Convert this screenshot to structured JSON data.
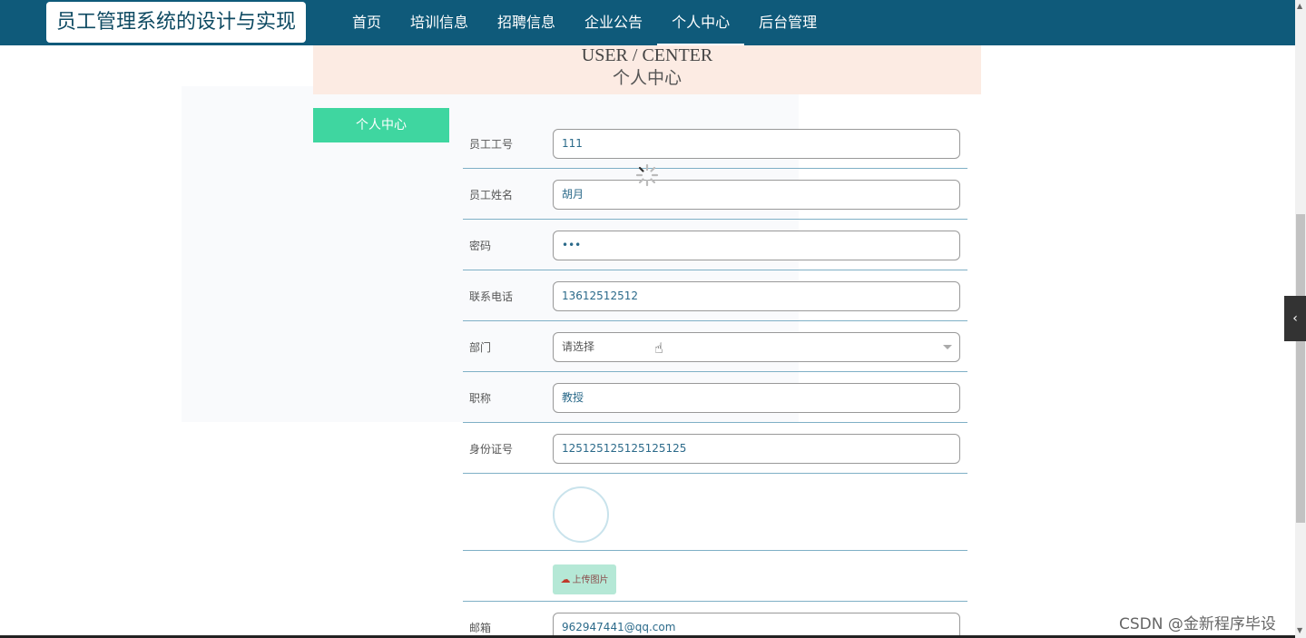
{
  "site": {
    "title": "员工管理系统的设计与实现"
  },
  "nav": [
    {
      "label": "首页",
      "active": false
    },
    {
      "label": "培训信息",
      "active": false
    },
    {
      "label": "招聘信息",
      "active": false
    },
    {
      "label": "企业公告",
      "active": false
    },
    {
      "label": "个人中心",
      "active": true
    },
    {
      "label": "后台管理",
      "active": false
    }
  ],
  "banner": {
    "en": "USER / CENTER",
    "cn": "个人中心"
  },
  "side": {
    "button_label": "个人中心"
  },
  "form": {
    "employee_id": {
      "label": "员工工号",
      "value": "111"
    },
    "name": {
      "label": "员工姓名",
      "value": "胡月"
    },
    "password": {
      "label": "密码",
      "value": "•••"
    },
    "phone": {
      "label": "联系电话",
      "value": "13612512512"
    },
    "department": {
      "label": "部门",
      "value": "请选择"
    },
    "title": {
      "label": "职称",
      "value": "教授"
    },
    "id_card": {
      "label": "身份证号",
      "value": "125125125125125125"
    },
    "upload": {
      "label": "上传图片"
    },
    "email": {
      "label": "邮箱",
      "value": "962947441@qq.com"
    }
  },
  "watermark": "CSDN @金新程序毕设"
}
